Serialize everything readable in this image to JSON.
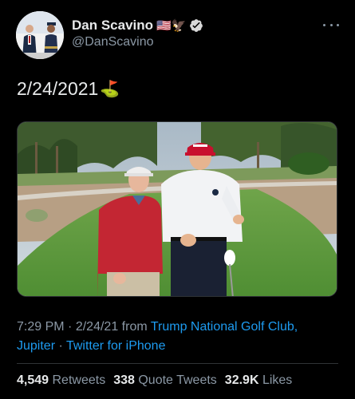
{
  "author": {
    "display_name": "Dan Scavino",
    "handle": "@DanScavino",
    "name_emoji": "🇺🇸🦅",
    "verified": true
  },
  "tweet": {
    "text": "2/24/2021",
    "text_emoji": "⛳"
  },
  "meta": {
    "time": "7:29 PM",
    "separator": "·",
    "date": "2/24/21",
    "from_label": "from",
    "location": "Trump National Golf Club, Jupiter",
    "client": "Twitter for iPhone"
  },
  "stats": {
    "retweets_count": "4,549",
    "retweets_label": "Retweets",
    "quotes_count": "338",
    "quotes_label": "Quote Tweets",
    "likes_count": "32.9K",
    "likes_label": "Likes"
  },
  "icons": {
    "verified": "verified-badge-icon",
    "more": "more-options-icon"
  },
  "colors": {
    "background": "#000000",
    "text_primary": "#e7e9ea",
    "text_secondary": "#8b98a5",
    "link": "#1d9bf0",
    "divider": "#2f3336"
  }
}
